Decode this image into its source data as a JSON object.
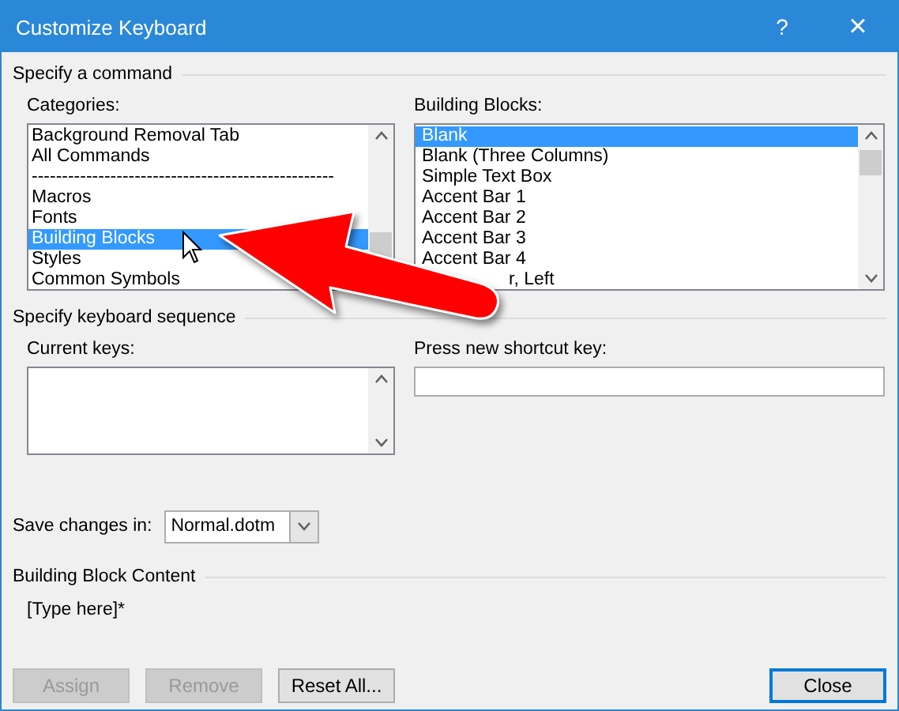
{
  "window": {
    "title": "Customize Keyboard",
    "help": "?",
    "close": "×"
  },
  "command_section": {
    "title": "Specify a command",
    "categories": {
      "label": "Categories:",
      "items": [
        {
          "text": "Background Removal Tab",
          "selected": false,
          "covered": false
        },
        {
          "text": "All Commands",
          "selected": false,
          "covered": false
        },
        {
          "text": "--------------------------------------------------",
          "selected": false,
          "covered": false
        },
        {
          "text": "Macros",
          "selected": false,
          "covered": false
        },
        {
          "text": "Fonts",
          "selected": false,
          "covered": false
        },
        {
          "text": "Building Blocks",
          "selected": true,
          "covered": false
        },
        {
          "text": "Styles",
          "selected": false,
          "covered": false
        },
        {
          "text": "Common Symbols",
          "selected": false,
          "covered": false
        }
      ]
    },
    "commands": {
      "label": "Building Blocks:",
      "items": [
        {
          "text": "Blank",
          "selected": true,
          "covered": false
        },
        {
          "text": "Blank (Three Columns)",
          "selected": false,
          "covered": false
        },
        {
          "text": "Simple Text Box",
          "selected": false,
          "covered": false
        },
        {
          "text": "Accent Bar 1",
          "selected": false,
          "covered": false
        },
        {
          "text": "Accent Bar 2",
          "selected": false,
          "covered": false
        },
        {
          "text": "Accent Bar 3",
          "selected": false,
          "covered": false
        },
        {
          "text": "Accent Bar 4",
          "selected": false,
          "covered": false
        },
        {
          "text": "r, Left",
          "selected": false,
          "covered": true
        }
      ]
    }
  },
  "keyboard_section": {
    "title": "Specify keyboard sequence",
    "current_keys_label": "Current keys:",
    "new_key_label": "Press new shortcut key:"
  },
  "save_changes": {
    "label": "Save changes in:",
    "value": "Normal.dotm"
  },
  "content_section": {
    "title": "Building Block Content",
    "text": "[Type here]*"
  },
  "buttons": [
    {
      "label": "Assign",
      "disabled": true,
      "default": false
    },
    {
      "label": "Remove",
      "disabled": true,
      "default": false
    },
    {
      "label": "Reset All...",
      "disabled": false,
      "default": false
    },
    {
      "label": "Close",
      "disabled": false,
      "default": true
    }
  ]
}
